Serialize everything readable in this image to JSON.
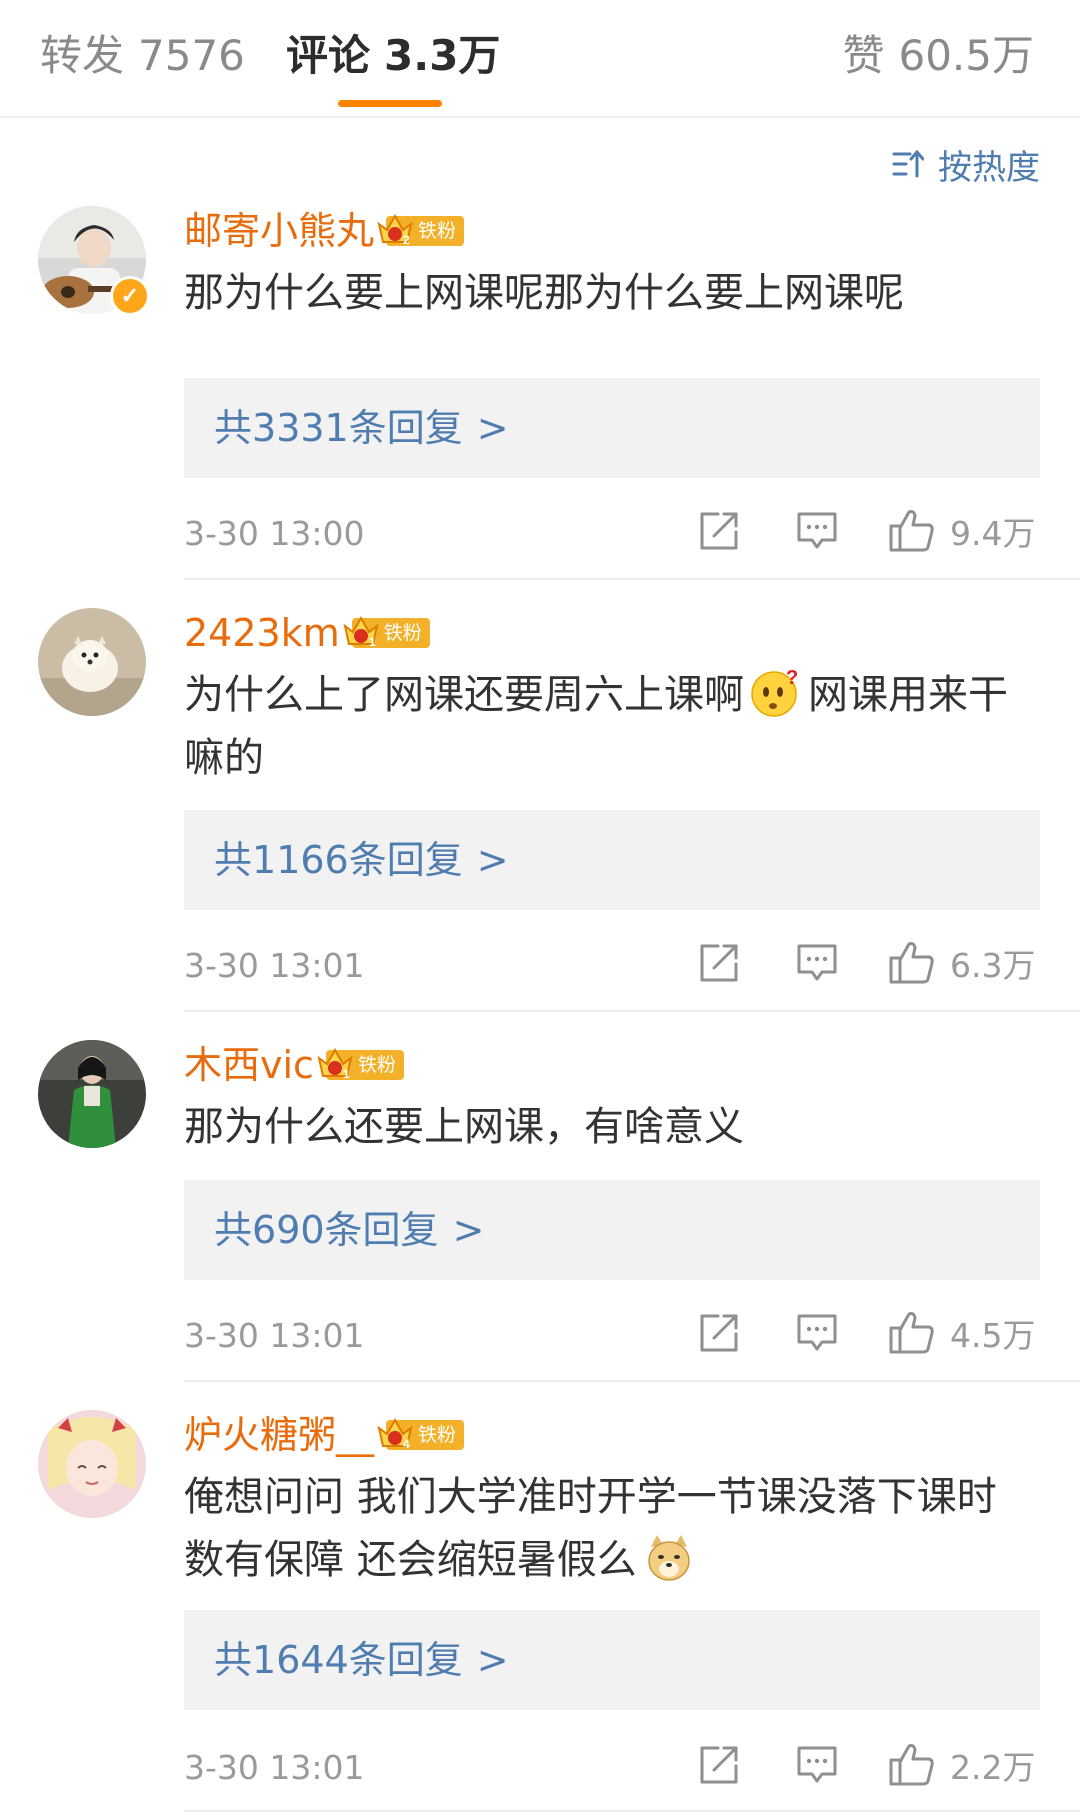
{
  "tabs": {
    "repost_label": "转发",
    "repost_count": "7576",
    "comments_label": "评论",
    "comments_count": "3.3万",
    "likes_label": "赞",
    "likes_count": "60.5万",
    "accent_color": "#ff8200"
  },
  "sort": {
    "icon": "sort-icon",
    "label": "按热度"
  },
  "colors": {
    "username": "#e86b0c",
    "link": "#507daf",
    "fan_badge": "#f3b12a",
    "verified_badge": "#ffa61a"
  },
  "comments": [
    {
      "username": "邮寄小熊丸",
      "fan_badge": "铁粉",
      "fan_level": "2",
      "verified": true,
      "text": "那为什么要上网课呢那为什么要上网课呢",
      "reply_prefix": "共",
      "reply_count": "3331",
      "reply_suffix": "条回复",
      "reply_arrow": ">",
      "timestamp": "3-30 13:00",
      "likes": "9.4万"
    },
    {
      "username": "2423km",
      "fan_badge": "铁粉",
      "fan_level": "1",
      "verified": false,
      "text_part1": "为什么上了网课还要周六上课啊",
      "text_emoji": "thinking-emoji",
      "text_part2": "网课用来干嘛的",
      "reply_prefix": "共",
      "reply_count": "1166",
      "reply_suffix": "条回复",
      "reply_arrow": ">",
      "timestamp": "3-30 13:01",
      "likes": "6.3万"
    },
    {
      "username": "木西vic",
      "fan_badge": "铁粉",
      "fan_level": "1",
      "verified": false,
      "text": "那为什么还要上网课，有啥意义",
      "reply_prefix": "共",
      "reply_count": "690",
      "reply_suffix": "条回复",
      "reply_arrow": ">",
      "timestamp": "3-30 13:01",
      "likes": "4.5万"
    },
    {
      "username": "炉火糖粥__",
      "fan_badge": "铁粉",
      "fan_level": "4",
      "verified": false,
      "text_part1": "俺想问问 我们大学准时开学一节课没落下课时数有保障 还会缩短暑假么",
      "text_emoji": "doge-emoji",
      "reply_prefix": "共",
      "reply_count": "1644",
      "reply_suffix": "条回复",
      "reply_arrow": ">",
      "timestamp": "3-30 13:01",
      "likes": "2.2万"
    }
  ]
}
